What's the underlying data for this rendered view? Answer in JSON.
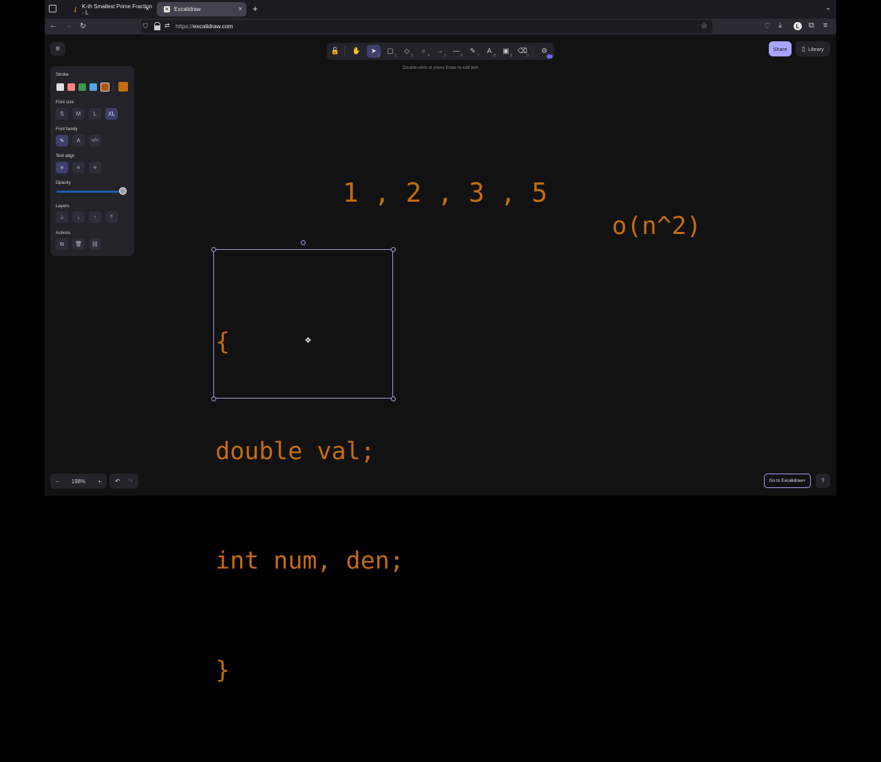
{
  "browser": {
    "tabs": [
      {
        "label": "K-th Smallest Prime Fraction - L",
        "close": "×"
      },
      {
        "label": "Excalidraw",
        "close": "×"
      }
    ],
    "new_tab": "+",
    "url_scheme": "https://",
    "url_host": "excalidraw.com"
  },
  "toolbar": {
    "tools": [
      {
        "icon": "lock-icon",
        "glyph": "🔓",
        "key": ""
      },
      {
        "icon": "hand-icon",
        "glyph": "✋",
        "key": ""
      },
      {
        "icon": "selection-icon",
        "glyph": "➤",
        "key": "1"
      },
      {
        "icon": "rectangle-icon",
        "glyph": "▢",
        "key": "2"
      },
      {
        "icon": "diamond-icon",
        "glyph": "◇",
        "key": "3"
      },
      {
        "icon": "ellipse-icon",
        "glyph": "○",
        "key": "4"
      },
      {
        "icon": "arrow-icon",
        "glyph": "→",
        "key": "5"
      },
      {
        "icon": "line-icon",
        "glyph": "—",
        "key": "6"
      },
      {
        "icon": "pencil-icon",
        "glyph": "✎",
        "key": "7"
      },
      {
        "icon": "text-icon",
        "glyph": "A",
        "key": "8"
      },
      {
        "icon": "image-icon",
        "glyph": "▣",
        "key": "9"
      },
      {
        "icon": "eraser-icon",
        "glyph": "⌫",
        "key": "0"
      },
      {
        "icon": "extra-tools-icon",
        "glyph": "⚙",
        "key": ""
      }
    ],
    "hint": "Double-click or press Enter to edit text"
  },
  "top_right": {
    "share": "Share",
    "library": "Library"
  },
  "panel": {
    "stroke_label": "Stroke",
    "stroke_colors": [
      "#e0e0e0",
      "#ff8383",
      "#3a994c",
      "#56a2e8",
      "#b2580c"
    ],
    "stroke_current": "#c46c12",
    "font_size_label": "Font size",
    "font_sizes": [
      "S",
      "M",
      "L",
      "XL"
    ],
    "font_family_label": "Font family",
    "text_align_label": "Text align",
    "opacity_label": "Opacity",
    "opacity_value": 100,
    "layers_label": "Layers",
    "actions_label": "Actions"
  },
  "canvas": {
    "sequence": "1 , 2 , 3 , 5",
    "complexity": "o(n^2)",
    "code_lines": [
      "{",
      "double val;",
      "int num, den;",
      "}"
    ]
  },
  "footer": {
    "zoom": "198%",
    "zoom_out": "−",
    "zoom_in": "+",
    "cta": "Go to Excalidraw+",
    "help": "?"
  }
}
